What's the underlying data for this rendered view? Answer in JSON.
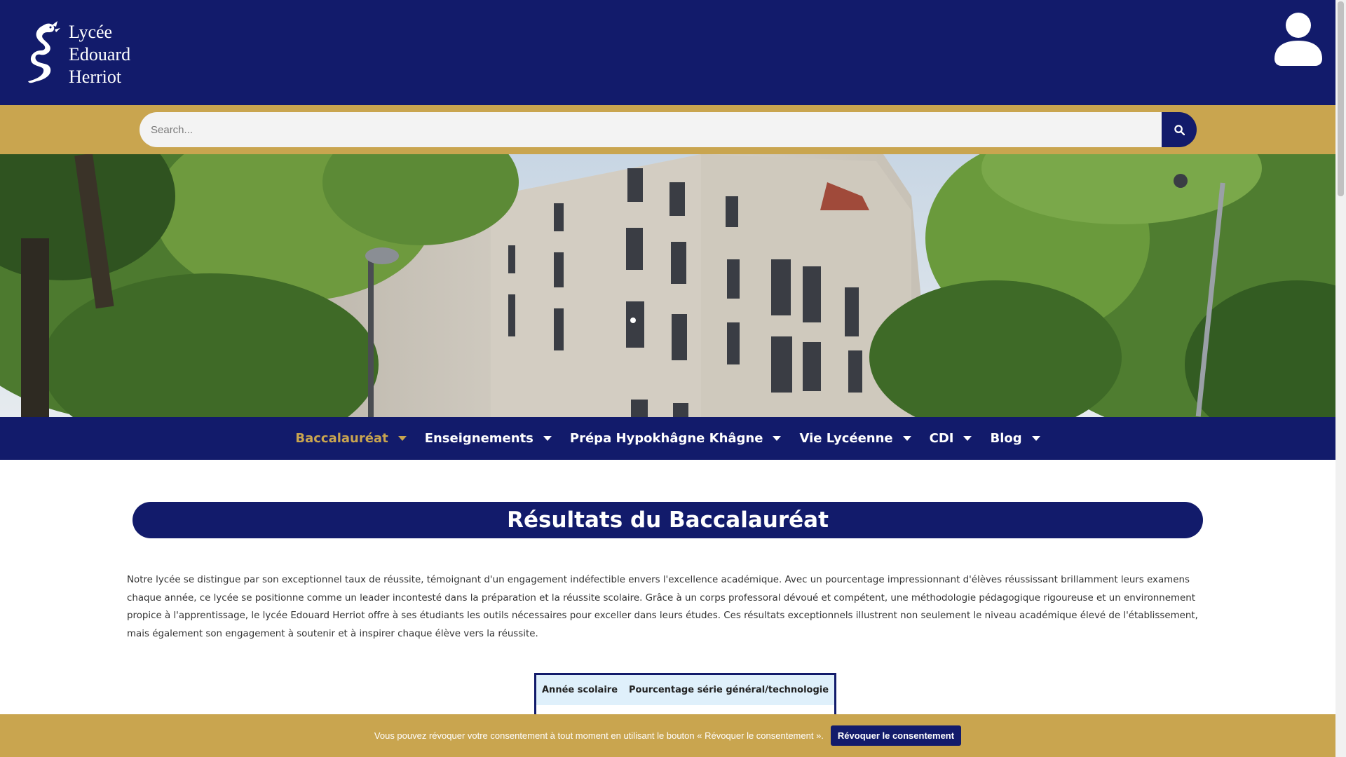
{
  "colors": {
    "brand_navy": "#121b6b",
    "brand_gold": "#c9a54f",
    "table_header": "#dff0fb"
  },
  "header": {
    "logo_lines": [
      "Lycée",
      "Edouard",
      "Herriot"
    ],
    "logo_icon": "dragon-emblem-icon",
    "user_icon": "user-account-icon"
  },
  "search": {
    "placeholder": "Search...",
    "icon": "search-icon"
  },
  "nav": {
    "items": [
      {
        "label": "Baccalauréat",
        "active": true
      },
      {
        "label": "Enseignements",
        "active": false
      },
      {
        "label": "Prépa Hypokhâgne Khâgne",
        "active": false
      },
      {
        "label": "Vie Lycéenne",
        "active": false
      },
      {
        "label": "CDI",
        "active": false
      },
      {
        "label": "Blog",
        "active": false
      }
    ]
  },
  "main": {
    "title": "Résultats du Baccalauréat",
    "intro": "Notre lycée se distingue par son exceptionnel taux de réussite, témoignant d'un engagement indéfectible envers l'excellence académique. Avec un pourcentage impressionnant d'élèves réussissant brillamment leurs examens chaque année, ce lycée se positionne comme un leader incontesté dans la préparation et la réussite scolaire. Grâce à un corps professoral dévoué et compétent, une méthodologie pédagogique rigoureuse et un environnement propice à l'apprentissage, le lycée Edouard Herriot offre à ses étudiants les outils nécessaires pour exceller dans leurs études. Ces résultats exceptionnels illustrent non seulement le niveau académique élevé de l'établissement, mais également son engagement à soutenir et à inspirer chaque élève vers la réussite.",
    "table": {
      "headers": [
        "Année scolaire",
        "Pourcentage série général/technologie"
      ]
    }
  },
  "cookie": {
    "text": "Vous pouvez révoquer votre consentement à tout moment en utilisant le bouton « Révoquer le consentement ».",
    "button": "Révoquer le consentement"
  }
}
